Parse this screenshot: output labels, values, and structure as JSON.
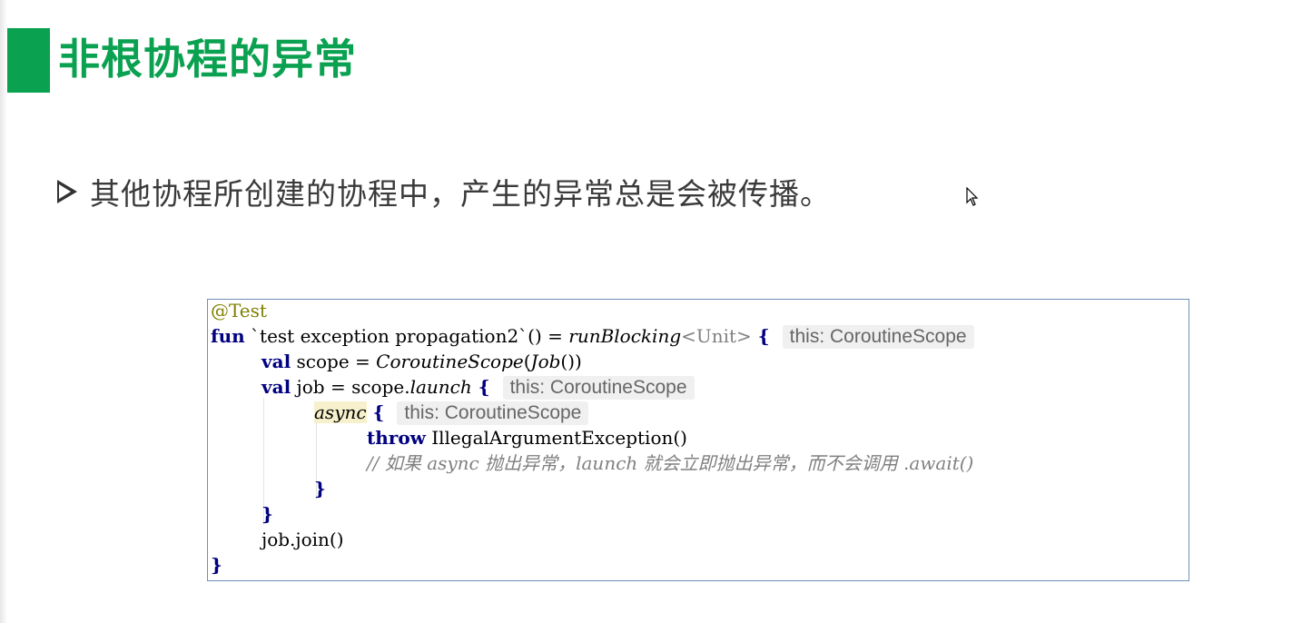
{
  "slide": {
    "title": "非根协程的异常",
    "bullet": "其他协程所创建的协程中，产生的异常总是会被传播。"
  },
  "colors": {
    "accent_green": "#0aa150",
    "keyword": "#000080",
    "annotation": "#808000",
    "comment": "#808080",
    "panel_border": "#6f8fb8"
  },
  "code": {
    "annotation": "@Test",
    "l1_fun": "fun",
    "l1_name": " `test exception propagation2`() = ",
    "l1_run": "runBlocking",
    "l1_type": "<Unit>",
    "l1_brace": " {",
    "hint_scope": "this: CoroutineScope",
    "l2_val": "val",
    "l2_a": " scope = ",
    "l2_scope": "CoroutineScope",
    "l2_b": "(",
    "l2_job": "Job",
    "l2_c": "())",
    "l3_val": "val",
    "l3_a": " job = scope.",
    "l3_launch": "launch",
    "l3_brace": " {",
    "l4_async": "async",
    "l4_brace": " {",
    "l5_throw": "throw",
    "l5_rest": " IllegalArgumentException()",
    "l6_comment": "// 如果 async 抛出异常，launch 就会立即抛出异常，而不会调用 .await()",
    "l7_close": "}",
    "l8_close": "}",
    "l9_join": "job.join()",
    "l10_close": "}"
  }
}
